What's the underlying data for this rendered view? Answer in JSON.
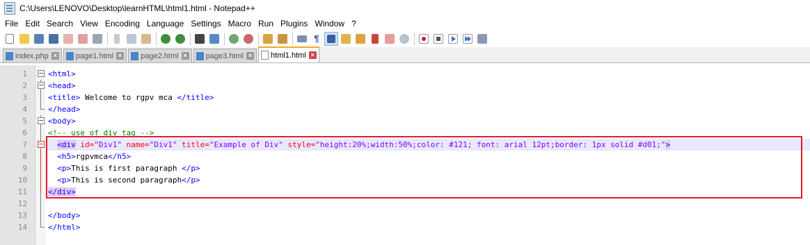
{
  "window": {
    "title": "C:\\Users\\LENOVO\\Desktop\\learnHTML\\html1.html - Notepad++"
  },
  "menu": {
    "items": [
      "File",
      "Edit",
      "Search",
      "View",
      "Encoding",
      "Language",
      "Settings",
      "Macro",
      "Run",
      "Plugins",
      "Window",
      "?"
    ]
  },
  "toolbar": {
    "icons": [
      "new-file-icon",
      "open-file-icon",
      "save-icon",
      "save-all-icon",
      "close-icon",
      "close-all-icon",
      "print-icon",
      "cut-icon",
      "copy-icon",
      "paste-icon",
      "undo-icon",
      "redo-icon",
      "find-icon",
      "replace-icon",
      "zoom-in-icon",
      "zoom-out-icon",
      "sync-v-icon",
      "sync-h-icon",
      "word-wrap-icon",
      "show-all-chars-icon",
      "indent-guide-icon",
      "doc-map-icon",
      "function-list-icon",
      "folder-icon",
      "monitor-icon",
      "record-icon",
      "stop-icon",
      "play-icon",
      "play-multiple-icon",
      "save-macro-icon"
    ]
  },
  "tabs": [
    {
      "label": "index.php",
      "active": false
    },
    {
      "label": "page1.html",
      "active": false
    },
    {
      "label": "page2.html",
      "active": false
    },
    {
      "label": "page3.html",
      "active": false
    },
    {
      "label": "html1.html",
      "active": true
    }
  ],
  "editor": {
    "line_numbers": [
      "1",
      "2",
      "3",
      "4",
      "5",
      "6",
      "7",
      "8",
      "9",
      "10",
      "11",
      "12",
      "13",
      "14"
    ],
    "lines": {
      "l1": "<html>",
      "l2": "<head>",
      "l3_open": "<title>",
      "l3_text": " Welcome to rgpv mca ",
      "l3_close": "</title>",
      "l4": "</head>",
      "l5": "<body>",
      "l6": "<!-- use of div tag -->",
      "l7_div_open": "<div",
      "l7_id_attr": "id=",
      "l7_id_val": "\"Div1\"",
      "l7_name_attr": "name=",
      "l7_name_val": "\"Div1\"",
      "l7_title_attr": "title=",
      "l7_title_val": "\"Example of Div\"",
      "l7_style_attr": "style=",
      "l7_style_val": "\"height:20%;width:50%;color: #121; font: arial 12pt;border: 1px solid #d01;\"",
      "l7_close": ">",
      "l8_open": "<h5>",
      "l8_text": "rgpvmca",
      "l8_close": "</h5>",
      "l9_open": "<p>",
      "l9_text": "This is first paragraph ",
      "l9_close": "</p>",
      "l10_open": "<p>",
      "l10_text": "This is second paragraph",
      "l10_close": "</p>",
      "l11": "</div>",
      "l12": "",
      "l13": "</body>",
      "l14": "</html>"
    }
  },
  "colors": {
    "tag": "#0000ff",
    "attribute": "#ff0000",
    "value": "#8000ff",
    "comment": "#008000",
    "highlight_box": "#e21b2b"
  }
}
